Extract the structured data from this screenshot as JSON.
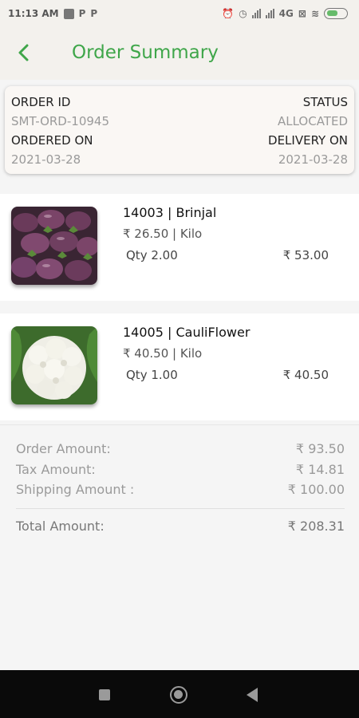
{
  "status_bar": {
    "time": "11:13 AM",
    "notification_icons": [
      "message-icon",
      "p-icon",
      "p-icon"
    ],
    "network": "4G",
    "right_icons": [
      "alarm-icon",
      "clock-icon",
      "signal-icon",
      "signal-icon",
      "4g-icon",
      "no-sim-icon",
      "wifi-icon",
      "battery-icon"
    ]
  },
  "header": {
    "title": "Order Summary",
    "accent_color": "#3fa64a"
  },
  "order_info": {
    "order_id_label": "ORDER ID",
    "order_id_value": "SMT-ORD-10945",
    "status_label": "STATUS",
    "status_value": "ALLOCATED",
    "ordered_on_label": "ORDERED ON",
    "ordered_on_value": "2021-03-28",
    "delivery_on_label": "DELIVERY ON",
    "delivery_on_value": "2021-03-28"
  },
  "items": [
    {
      "name": "14003 | Brinjal",
      "price": "₹ 26.50 | Kilo",
      "qty": "Qty 2.00",
      "total": "₹ 53.00",
      "image": "brinjal-image"
    },
    {
      "name": "14005 | CauliFlower",
      "price": "₹ 40.50 | Kilo",
      "qty": "Qty 1.00",
      "total": "₹ 40.50",
      "image": "cauliflower-image"
    }
  ],
  "summary": {
    "order_amount_label": "Order Amount:",
    "order_amount_value": "₹ 93.50",
    "tax_amount_label": "Tax Amount:",
    "tax_amount_value": "₹ 14.81",
    "shipping_amount_label": "Shipping Amount :",
    "shipping_amount_value": "₹ 100.00",
    "total_amount_label": "Total Amount:",
    "total_amount_value": "₹ 208.31"
  }
}
